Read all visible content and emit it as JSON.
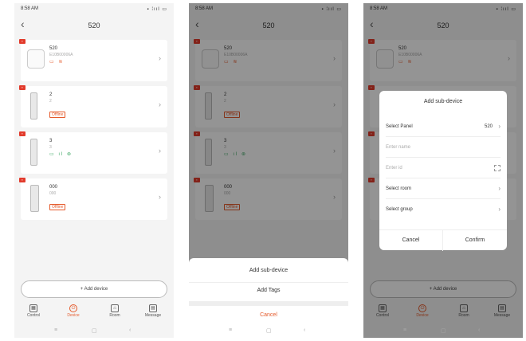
{
  "status": {
    "time": "8:58 AM",
    "indicators": "▪ ⁞ııl ▭"
  },
  "header": {
    "back_glyph": "‹",
    "title": "520"
  },
  "devices": [
    {
      "name": "520",
      "sub": "E10B00006A",
      "icons": "▭ ≋",
      "tag": ""
    },
    {
      "name": "2",
      "sub": "2",
      "icons": "",
      "tag": "Offline"
    },
    {
      "name": "3",
      "sub": "3",
      "icons": "▭ ıl ⊛",
      "tag": ""
    },
    {
      "name": "000",
      "sub": "000",
      "icons": "",
      "tag": "Offline"
    }
  ],
  "add_device_label": "+ Add device",
  "tabs": [
    {
      "label": "Control",
      "icon": "▦"
    },
    {
      "label": "Device",
      "icon": "⏻"
    },
    {
      "label": "Room",
      "icon": "⌂"
    },
    {
      "label": "Message",
      "icon": "▤"
    }
  ],
  "navbar": {
    "menu": "≡",
    "home": "▢",
    "back": "‹"
  },
  "sheet": {
    "add_sub_device": "Add sub-device",
    "add_tags": "Add Tags",
    "cancel": "Cancel"
  },
  "dialog": {
    "title": "Add sub-device",
    "select_panel_label": "Select Panel",
    "select_panel_value": "520",
    "name_placeholder": "Enter name",
    "id_placeholder": "Enter id",
    "select_room_label": "Select room",
    "select_group_label": "Select group",
    "cancel": "Cancel",
    "confirm": "Confirm"
  },
  "colors": {
    "accent": "#e55a2b",
    "badge": "#e23b2c",
    "online": "#3aa662"
  }
}
